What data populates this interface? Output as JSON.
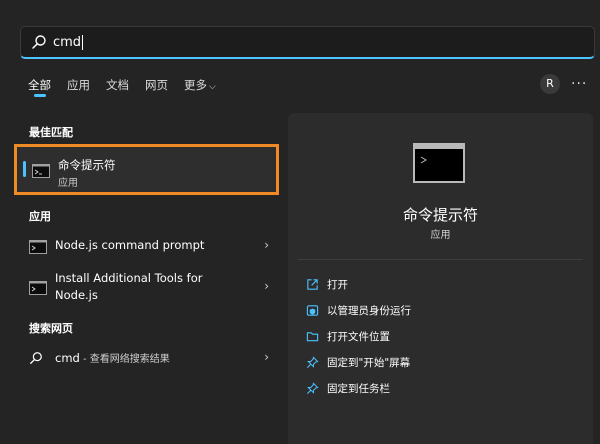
{
  "search": {
    "query": "cmd"
  },
  "tabs": [
    {
      "label": "全部",
      "active": true
    },
    {
      "label": "应用",
      "active": false
    },
    {
      "label": "文档",
      "active": false
    },
    {
      "label": "网页",
      "active": false
    },
    {
      "label": "更多",
      "active": false
    }
  ],
  "header": {
    "avatar_initial": "R",
    "more_glyph": "···"
  },
  "best_match": {
    "section_title": "最佳匹配",
    "name": "命令提示符",
    "type": "应用"
  },
  "apps": {
    "section_title": "应用",
    "items": [
      {
        "label": "Node.js command prompt"
      },
      {
        "label_line1": "Install Additional Tools for",
        "label_line2": "Node.js"
      }
    ]
  },
  "web": {
    "section_title": "搜索网页",
    "item_query": "cmd",
    "item_suffix": " - 查看网络搜索结果"
  },
  "detail": {
    "title": "命令提示符",
    "subtitle": "应用",
    "actions": [
      {
        "label": "打开",
        "icon": "open-icon"
      },
      {
        "label": "以管理员身份运行",
        "icon": "shield-icon"
      },
      {
        "label": "打开文件位置",
        "icon": "folder-icon"
      },
      {
        "label": "固定到\"开始\"屏幕",
        "icon": "pin-icon"
      },
      {
        "label": "固定到任务栏",
        "icon": "pin-icon"
      }
    ]
  },
  "colors": {
    "accent": "#4cc2ff",
    "highlight_border": "#f08a24",
    "background": "#242424",
    "panel": "#2c2c2c"
  }
}
